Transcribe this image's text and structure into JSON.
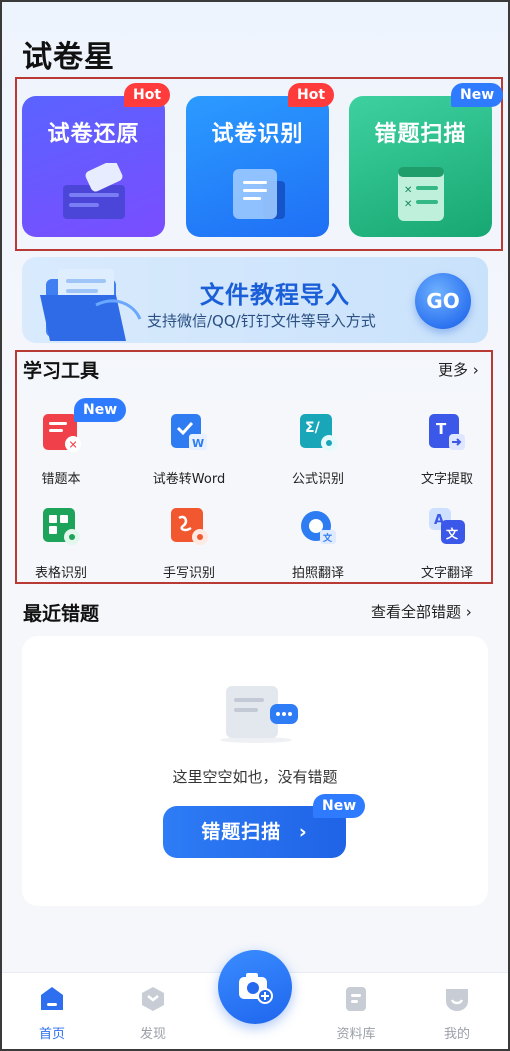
{
  "app_title": "试卷星",
  "features": [
    {
      "title": "试卷还原",
      "badge": "Hot"
    },
    {
      "title": "试卷识别",
      "badge": "Hot"
    },
    {
      "title": "错题扫描",
      "badge": "New"
    }
  ],
  "banner": {
    "title": "文件教程导入",
    "subtitle": "支持微信/QQ/钉钉文件等导入方式",
    "go_label": "GO"
  },
  "tools": {
    "title": "学习工具",
    "more": "更多",
    "items": [
      {
        "label": "错题本",
        "badge": "New",
        "icon": "mistake-book-icon"
      },
      {
        "label": "试卷转Word",
        "icon": "paper-to-word-icon"
      },
      {
        "label": "公式识别",
        "icon": "formula-recognition-icon"
      },
      {
        "label": "文字提取",
        "icon": "text-extract-icon"
      },
      {
        "label": "表格识别",
        "icon": "table-recognition-icon"
      },
      {
        "label": "手写识别",
        "icon": "handwriting-recognition-icon"
      },
      {
        "label": "拍照翻译",
        "icon": "photo-translate-icon"
      },
      {
        "label": "文字翻译",
        "icon": "text-translate-icon"
      }
    ]
  },
  "recent": {
    "title": "最近错题",
    "view_all": "查看全部错题",
    "empty_text": "这里空空如也，没有错题",
    "scan_button": "错题扫描",
    "scan_badge": "New"
  },
  "tabbar": {
    "items": [
      {
        "label": "首页",
        "active": true
      },
      {
        "label": "发现"
      },
      {
        "label": "资料库"
      },
      {
        "label": "我的"
      }
    ]
  },
  "colors": {
    "primary": "#2E6FF0",
    "hot": "#FF3B3B",
    "highlight_box": "#B93A35"
  }
}
